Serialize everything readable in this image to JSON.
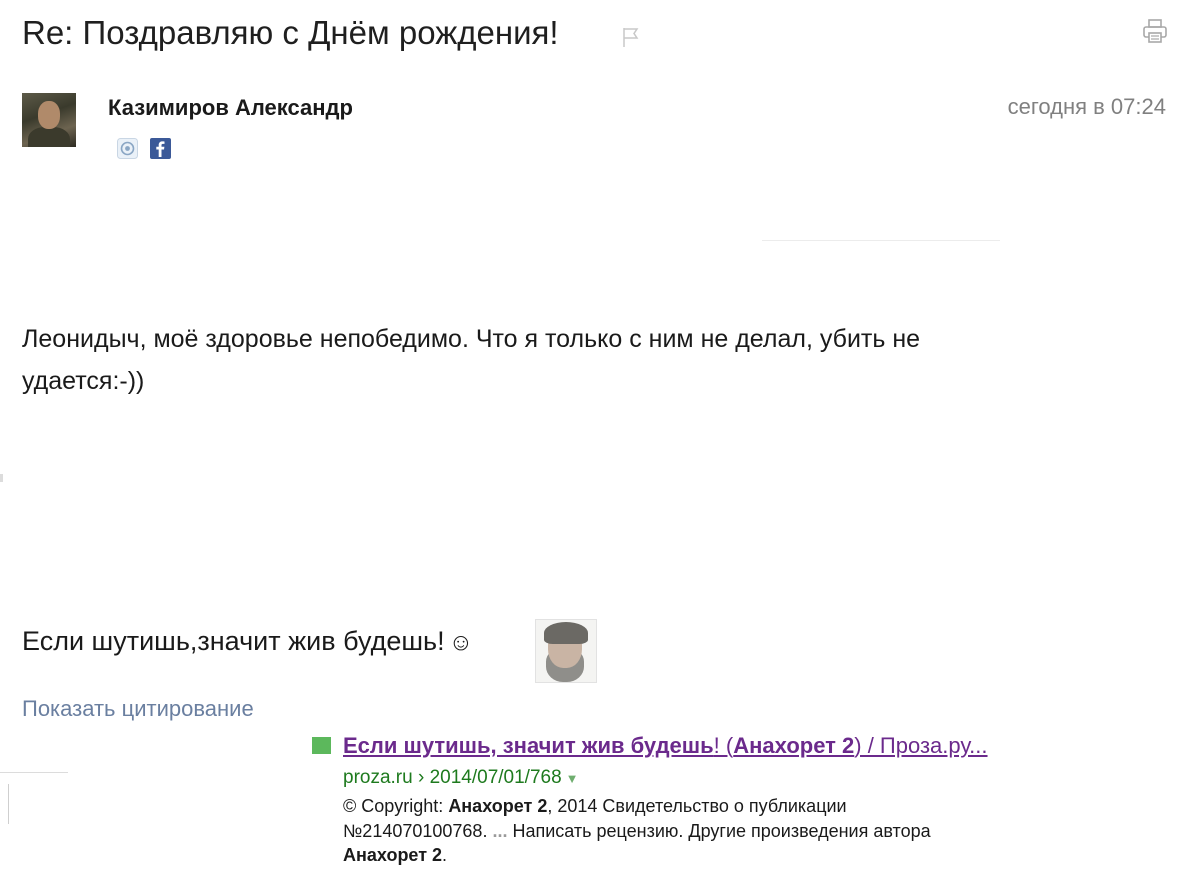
{
  "email": {
    "subject": "Re: Поздравляю с Днём рождения!",
    "sender_name": "Казимиров Александр",
    "date": "сегодня в 07:24",
    "body_line1": "Леонидыч, моё здоровье непобедимо. Что я только с ним не делал, убить не",
    "body_line2": "удается:-))",
    "signature": "Если шутишь,значит жив будешь!",
    "smiley": "☺",
    "show_quote": "Показать цитирование"
  },
  "icons": {
    "flag": "flag-icon",
    "print": "print-icon",
    "mailru": "mailru-icon",
    "facebook": "facebook-icon"
  },
  "search_result": {
    "title_part1": "Если шутишь, значит жив будешь",
    "title_part2": "! (",
    "title_part3": "Анахорет 2",
    "title_part4": ") / Проза.ру...",
    "url_host": "proza.ru",
    "url_sep": " › ",
    "url_path": "2014/07/01/768",
    "url_arrow": "▼",
    "snippet_1": "© Copyright: ",
    "snippet_author_1": "Анахорет 2",
    "snippet_2": ", 2014 Свидетельство о публикации",
    "snippet_3": "№214070100768. ",
    "snippet_ellipsis": "...",
    "snippet_4": " Написать рецензию. Другие произведения автора",
    "snippet_author_2": "Анахорет 2",
    "snippet_5": "."
  },
  "colors": {
    "link_visited": "#6b2a8c",
    "url_green": "#1e7a1e",
    "marker_green": "#5cb85c",
    "quote_link": "#6a7fa0",
    "date_gray": "#808080"
  }
}
